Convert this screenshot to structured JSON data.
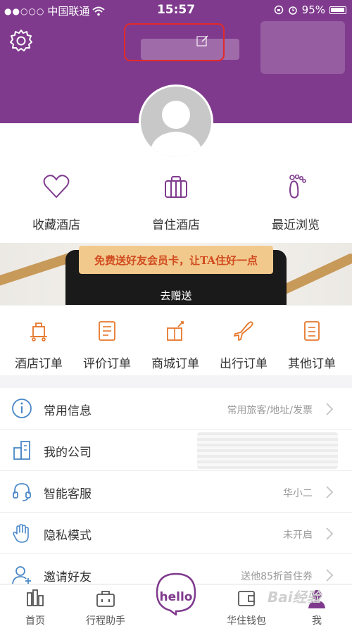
{
  "status_bar": {
    "carrier": "中国联通",
    "time": "15:57",
    "battery": "95%"
  },
  "quick_links": [
    {
      "label": "收藏酒店",
      "icon": "heart-icon"
    },
    {
      "label": "曾住酒店",
      "icon": "suitcase-icon"
    },
    {
      "label": "最近浏览",
      "icon": "footprint-icon"
    }
  ],
  "banner": {
    "headline": "免费送好友会员卡，让TA住好一点",
    "button": "去赠送"
  },
  "orders": [
    {
      "label": "酒店订单",
      "icon": "luggage-cart-icon"
    },
    {
      "label": "评价订单",
      "icon": "review-note-icon"
    },
    {
      "label": "商城订单",
      "icon": "gift-box-icon"
    },
    {
      "label": "出行订单",
      "icon": "airplane-icon"
    },
    {
      "label": "其他订单",
      "icon": "document-icon"
    }
  ],
  "menu": [
    {
      "label": "常用信息",
      "value": "常用旅客/地址/发票",
      "icon": "info-icon"
    },
    {
      "label": "我的公司",
      "value": "",
      "icon": "building-icon"
    },
    {
      "label": "智能客服",
      "value": "华小二",
      "icon": "headset-icon"
    },
    {
      "label": "隐私模式",
      "value": "未开启",
      "icon": "hand-icon"
    },
    {
      "label": "邀请好友",
      "value": "送他85折首住券",
      "icon": "add-user-icon"
    }
  ],
  "tabbar": [
    {
      "label": "首页",
      "icon": "home-chart-icon"
    },
    {
      "label": "行程助手",
      "icon": "briefcase-icon"
    },
    {
      "label": "华住钱包",
      "icon": "wallet-icon"
    },
    {
      "label": "我",
      "icon": "profile-icon"
    }
  ],
  "hello": "hello",
  "watermark": "Bai经验",
  "colors": {
    "brand": "#7f3a8d",
    "accent": "#e5772b"
  }
}
